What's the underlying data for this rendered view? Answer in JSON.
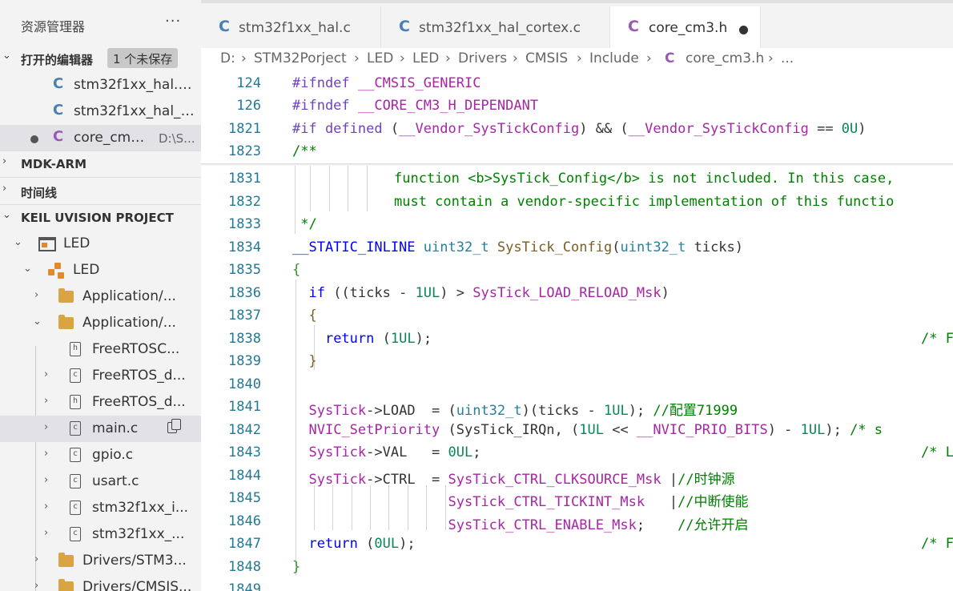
{
  "sidebar": {
    "title": "资源管理器",
    "more": "···",
    "open_editors": {
      "label": "打开的编辑器",
      "badge": "1 个未保存"
    },
    "open_files": [
      {
        "name": "stm32f1xx_hal.c...",
        "hint": ""
      },
      {
        "name": "stm32f1xx_hal_c...",
        "hint": ""
      },
      {
        "name": "core_cm3.h",
        "hint": "D:\\S..."
      }
    ],
    "sections": {
      "mdk": "MDK-ARM",
      "timeline": "时间线",
      "keil": "KEIL UVISION PROJECT"
    },
    "tree": {
      "project": "LED",
      "target": "LED",
      "folders": [
        "Application/...",
        "Application/..."
      ],
      "files": [
        "FreeRTOSC...",
        "FreeRTOS_d...",
        "FreeRTOS_d...",
        "main.c",
        "gpio.c",
        "usart.c",
        "stm32f1xx_i...",
        "stm32f1xx_..."
      ],
      "bottom_folders": [
        "Drivers/STM3...",
        "Drivers/CMSIS..."
      ]
    }
  },
  "tabs": [
    {
      "icon": "C",
      "label": "stm32f1xx_hal.c"
    },
    {
      "icon": "C",
      "label": "stm32f1xx_hal_cortex.c"
    },
    {
      "icon": "C",
      "label": "core_cm3.h"
    }
  ],
  "breadcrumb": [
    "D:",
    "STM32Porject",
    "LED",
    "LED",
    "Drivers",
    "CMSIS",
    "Include",
    "C",
    "core_cm3.h",
    "..."
  ],
  "breadcrumb_sep": "›",
  "colors": {
    "line_number": "#237893",
    "keyword": "#0000ff",
    "comment": "#008000",
    "accent_c": "#9b59b6"
  },
  "code": {
    "sticky": [
      {
        "num": "124",
        "text": "#ifndef __CMSIS_GENERIC"
      },
      {
        "num": "126",
        "text": "#ifndef __CORE_CM3_H_DEPENDANT"
      },
      {
        "num": "1821",
        "text": "#if defined (__Vendor_SysTickConfig) && (__Vendor_SysTickConfig == 0U)"
      },
      {
        "num": "1823",
        "text": "/**"
      }
    ],
    "lines": [
      {
        "num": "1831",
        "text": "function <b>SysTick_Config</b> is not included. In this case,"
      },
      {
        "num": "1832",
        "text": "must contain a vendor-specific implementation of this functio"
      },
      {
        "num": "1833",
        "text": " */"
      },
      {
        "num": "1834",
        "text": "__STATIC_INLINE uint32_t SysTick_Config(uint32_t ticks)"
      },
      {
        "num": "1835",
        "text": "{"
      },
      {
        "num": "1836",
        "text": "  if ((ticks - 1UL) > SysTick_LOAD_RELOAD_Msk)"
      },
      {
        "num": "1837",
        "text": "  {"
      },
      {
        "num": "1838",
        "text": "    return (1UL);"
      },
      {
        "num": "1839",
        "text": "  }"
      },
      {
        "num": "1840",
        "text": ""
      },
      {
        "num": "1841",
        "text": "  SysTick->LOAD  = (uint32_t)(ticks - 1UL); //配置71999"
      },
      {
        "num": "1842",
        "text": "  NVIC_SetPriority (SysTick_IRQn, (1UL << __NVIC_PRIO_BITS) - 1UL); /* s"
      },
      {
        "num": "1843",
        "text": "  SysTick->VAL   = 0UL;"
      },
      {
        "num": "1844",
        "text": "  SysTick->CTRL  = SysTick_CTRL_CLKSOURCE_Msk |//时钟源"
      },
      {
        "num": "1845",
        "text": "                   SysTick_CTRL_TICKINT_Msk   |//中断使能"
      },
      {
        "num": "1846",
        "text": "                   SysTick_CTRL_ENABLE_Msk;    //允许开启"
      },
      {
        "num": "1847",
        "text": "  return (0UL);"
      },
      {
        "num": "1848",
        "text": "}"
      },
      {
        "num": "1849",
        "text": ""
      }
    ],
    "trailing_comments": [
      "/* F",
      "/* L",
      "/* F"
    ]
  }
}
